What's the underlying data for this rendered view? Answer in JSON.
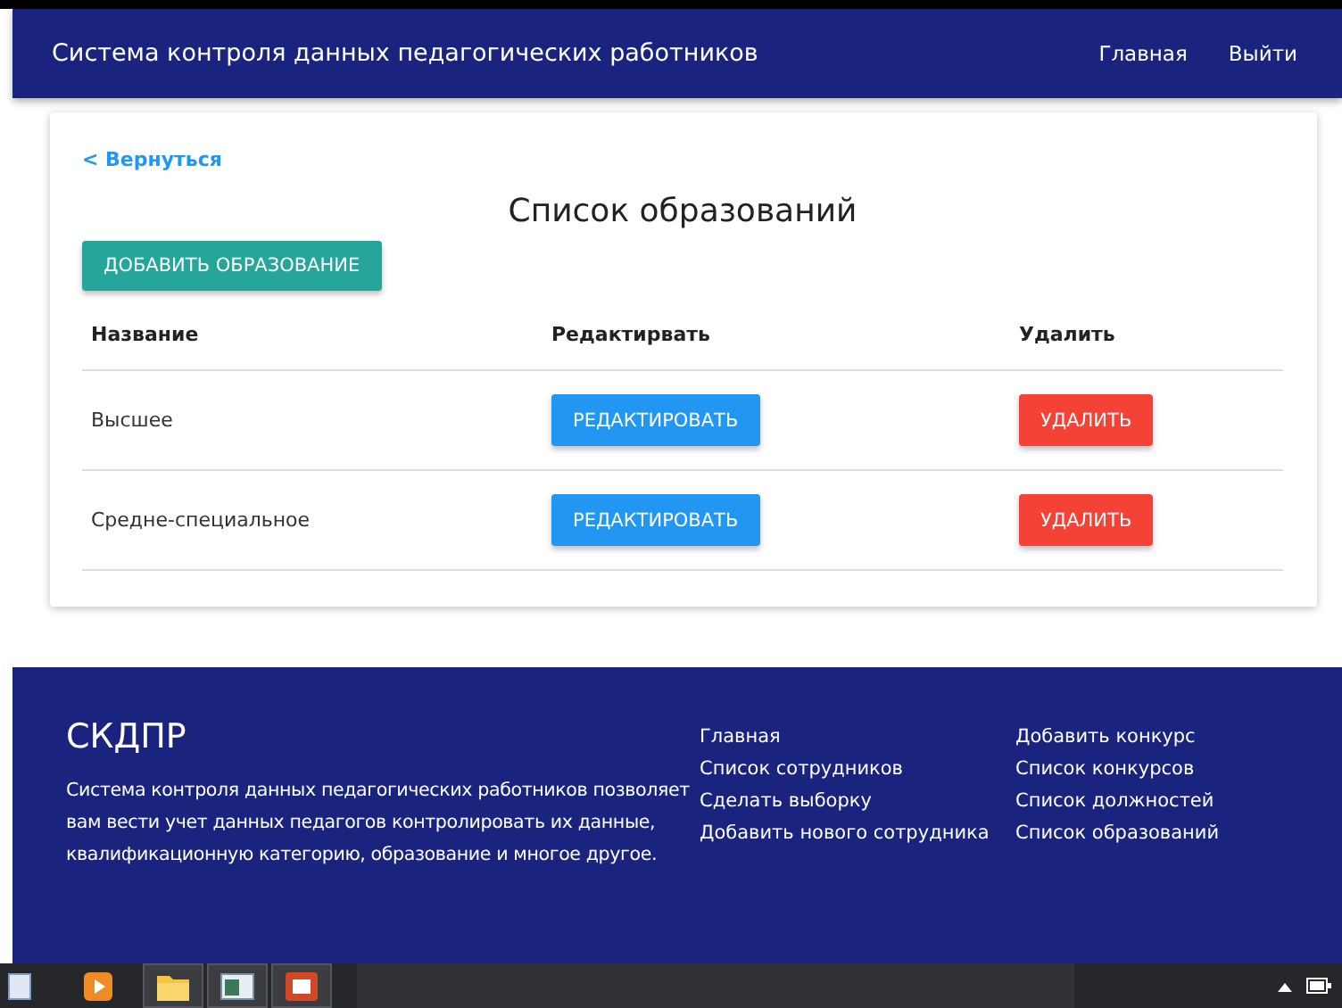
{
  "navbar": {
    "title": "Система контроля данных педагогических работников",
    "links": [
      "Главная",
      "Выйти"
    ]
  },
  "back_link": "< Вернуться",
  "heading": "Список образований",
  "add_button": "ДОБАВИТЬ ОБРАЗОВАНИЕ",
  "table": {
    "columns": [
      "Название",
      "Редактирвать",
      "Удалить"
    ],
    "rows": [
      {
        "name": "Высшее",
        "edit": "РЕДАКТИРОВАТЬ",
        "delete": "УДАЛИТЬ"
      },
      {
        "name": "Средне-специальное",
        "edit": "РЕДАКТИРОВАТЬ",
        "delete": "УДАЛИТЬ"
      }
    ]
  },
  "footer": {
    "brand": "СКДПР",
    "description": "Система контроля данных педагогических работников позволяет вам вести учет данных педагогов контролировать их данные, квалификационную категорию, образование и многое другое.",
    "links_1": [
      "Главная",
      "Список сотрудников",
      "Сделать выборку",
      "Добавить нового сотрудника"
    ],
    "links_2": [
      "Добавить конкурс",
      "Список конкурсов",
      "Список должностей",
      "Список образований"
    ]
  }
}
